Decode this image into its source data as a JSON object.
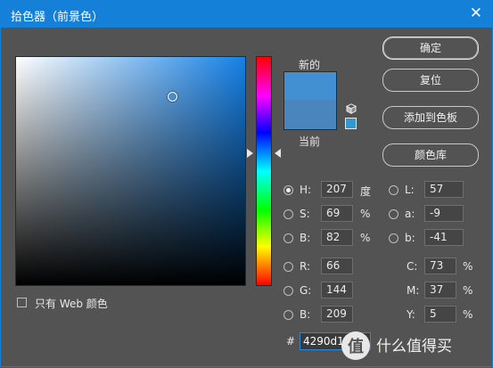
{
  "window": {
    "title": "拾色器（前景色）",
    "close_glyph": "✕"
  },
  "preview": {
    "new_label": "新的",
    "current_label": "当前",
    "new_color": "#4290d1",
    "current_color": "#4a86bd"
  },
  "buttons": {
    "ok": "确定",
    "reset": "复位",
    "add_swatches": "添加到色板",
    "libraries": "颜色库"
  },
  "hsb": {
    "h": {
      "label": "H:",
      "value": "207",
      "unit": "度"
    },
    "s": {
      "label": "S:",
      "value": "69",
      "unit": "%"
    },
    "b": {
      "label": "B:",
      "value": "82",
      "unit": "%"
    }
  },
  "lab": {
    "l": {
      "label": "L:",
      "value": "57"
    },
    "a": {
      "label": "a:",
      "value": "-9"
    },
    "b": {
      "label": "b:",
      "value": "-41"
    }
  },
  "rgb": {
    "r": {
      "label": "R:",
      "value": "66"
    },
    "g": {
      "label": "G:",
      "value": "144"
    },
    "b": {
      "label": "B:",
      "value": "209"
    }
  },
  "cmyk": {
    "c": {
      "label": "C:",
      "value": "73",
      "unit": "%"
    },
    "m": {
      "label": "M:",
      "value": "37",
      "unit": "%"
    },
    "y": {
      "label": "Y:",
      "value": "5",
      "unit": "%"
    }
  },
  "hex": {
    "label": "#",
    "value": "4290d1"
  },
  "web_only": {
    "label": "只有 Web 颜色",
    "checked": false
  },
  "watermark": {
    "text": "什么值得买"
  },
  "colors": {
    "titlebar": "#1580d8",
    "panel": "#535353",
    "hue": "#1580e6"
  }
}
